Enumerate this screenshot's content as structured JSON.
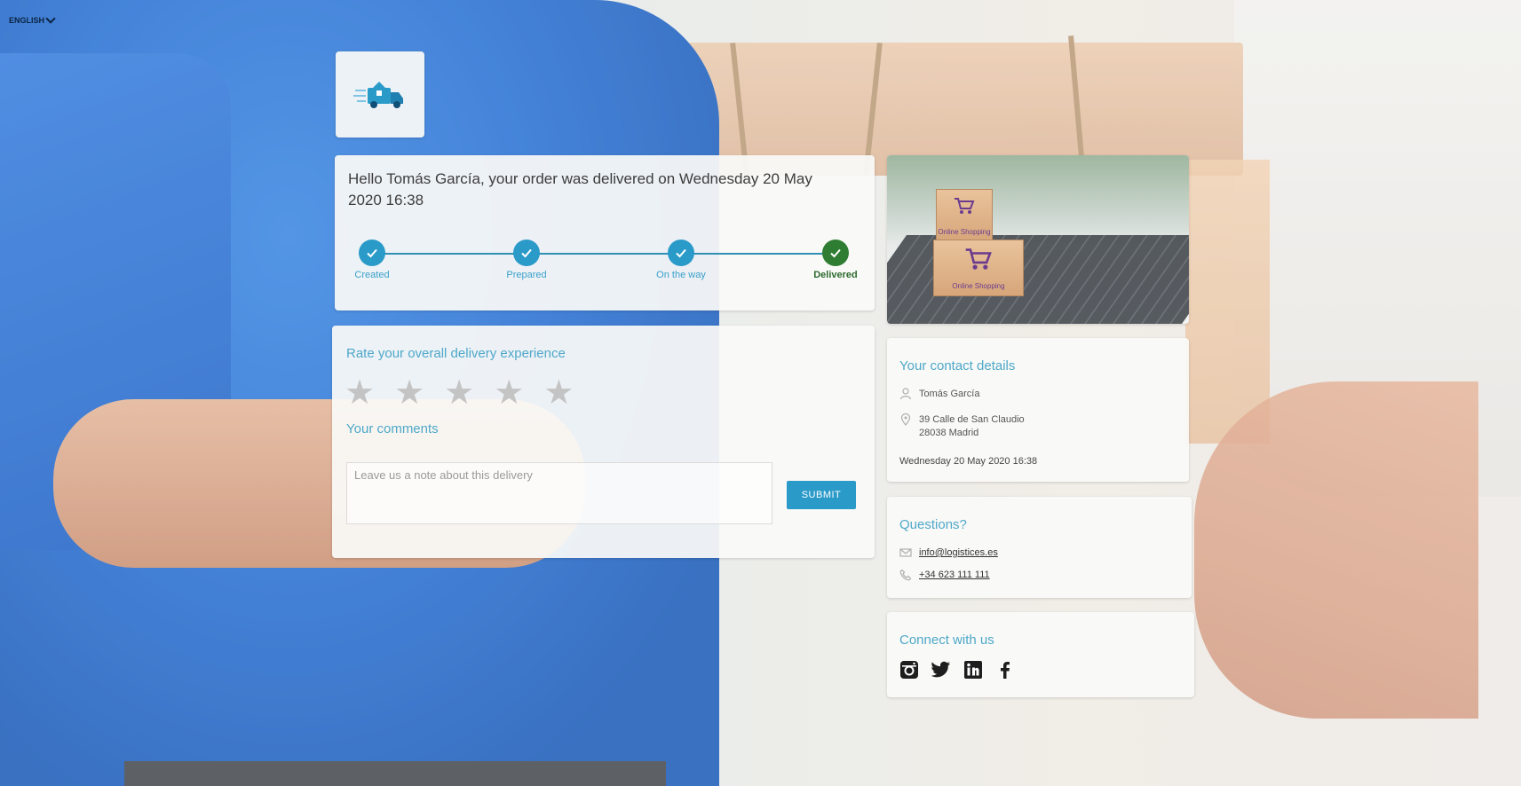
{
  "language": {
    "selected": "ENGLISH"
  },
  "status": {
    "title": "Hello Tomás García, your order was delivered on Wednesday 20 May 2020 16:38",
    "steps": [
      {
        "label": "Created"
      },
      {
        "label": "Prepared"
      },
      {
        "label": "On the way"
      },
      {
        "label": "Delivered"
      }
    ]
  },
  "rating": {
    "title": "Rate your overall delivery experience",
    "stars_total": 5,
    "stars_selected": 0,
    "comments_title": "Your comments",
    "note_placeholder": "Leave us a note about this delivery",
    "submit_label": "SUBMIT"
  },
  "photo": {
    "box_label_top": "Online Shopping",
    "box_label_bottom": "Online Shopping"
  },
  "contact": {
    "title": "Your contact details",
    "name": "Tomás García",
    "address_line1": "39 Calle de San Claudio",
    "address_line2": "28038 Madrid",
    "date": "Wednesday 20 May 2020 16:38"
  },
  "questions": {
    "title": "Questions?",
    "email": "info@logistices.es",
    "phone": "+34 623 111 111"
  },
  "social": {
    "title": "Connect with us",
    "icons": [
      "instagram-icon",
      "twitter-icon",
      "linkedin-icon",
      "facebook-icon"
    ]
  },
  "colors": {
    "accent": "#2a9ac9",
    "delivered": "#2e7d32",
    "star_inactive": "#c4c4c4"
  }
}
